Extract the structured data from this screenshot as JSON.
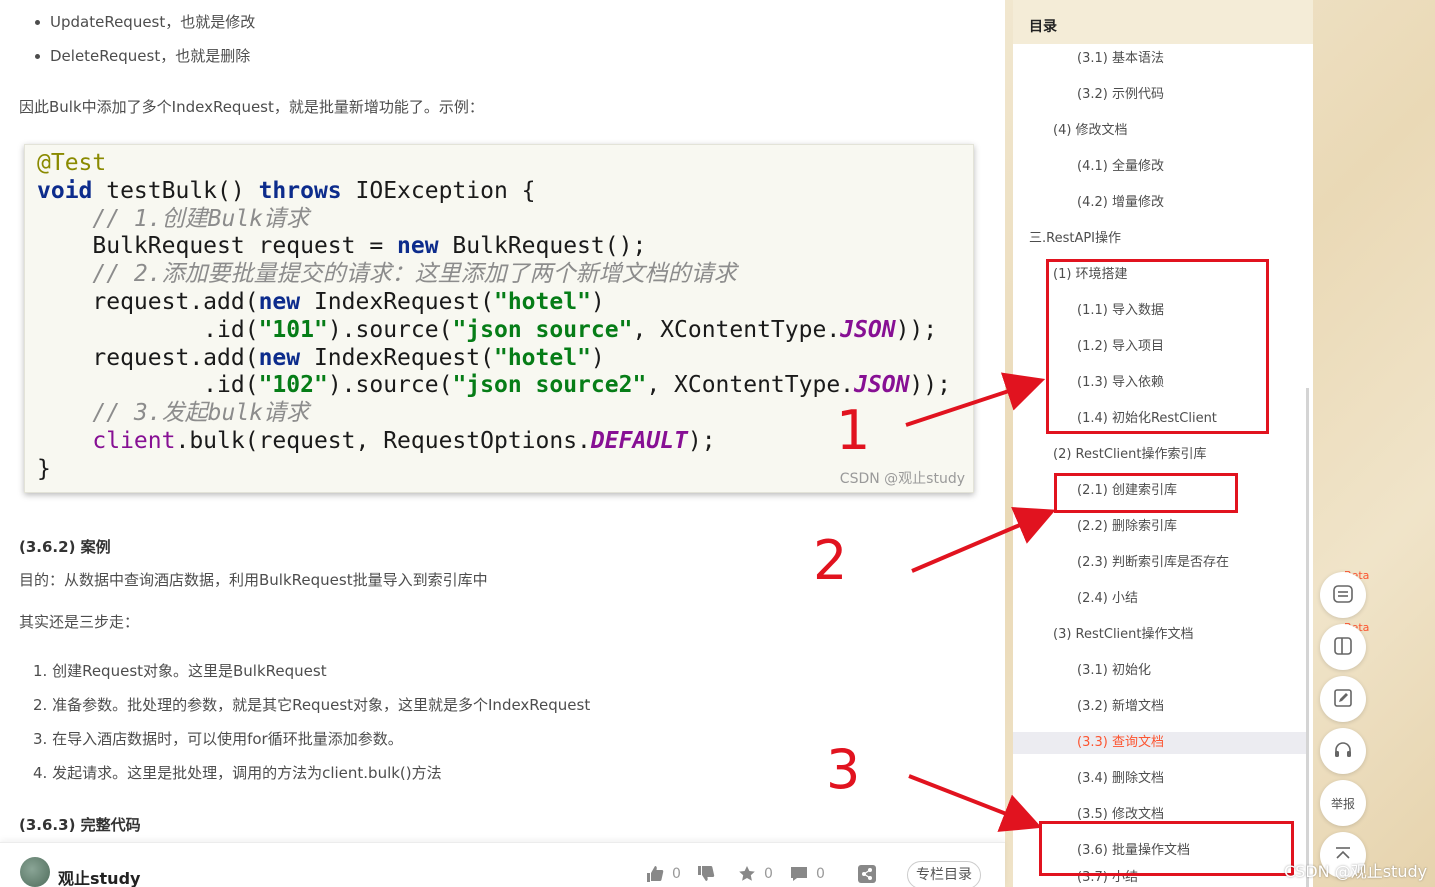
{
  "article": {
    "bullets": [
      "UpdateRequest，也就是修改",
      "DeleteRequest，也就是删除"
    ],
    "intro": "因此Bulk中添加了多个IndexRequest，就是批量新增功能了。示例：",
    "code_watermark": "CSDN @观止study",
    "section_case": "(3.6.2) 案例",
    "goal": "目的：从数据中查询酒店数据，利用BulkRequest批量导入到索引库中",
    "three_steps": "其实还是三步走：",
    "steps": [
      "1. 创建Request对象。这里是BulkRequest",
      "2. 准备参数。批处理的参数，就是其它Request对象，这里就是多个IndexRequest",
      "3. 在导入酒店数据时，可以使用for循环批量添加参数。",
      "4. 发起请求。这里是批处理，调用的方法为client.bulk()方法"
    ],
    "section_full_code": "(3.6.3) 完整代码"
  },
  "bottom_bar": {
    "author": "观止study",
    "like_count": "0",
    "dislike_count": "",
    "star_count": "0",
    "comment_count": "0",
    "column_button": "专栏目录"
  },
  "toc": {
    "title": "目录",
    "items": [
      "(3.1) 基本语法",
      "(3.2) 示例代码",
      "(4) 修改文档",
      "(4.1) 全量修改",
      "(4.2) 增量修改",
      "三.RestAPI操作",
      "(1) 环境搭建",
      "(1.1) 导入数据",
      "(1.2) 导入项目",
      "(1.3) 导入依赖",
      "(1.4) 初始化RestClient",
      "(2) RestClient操作索引库",
      "(2.1) 创建索引库",
      "(2.2) 删除索引库",
      "(2.3) 判断索引库是否存在",
      "(2.4) 小结",
      "(3) RestClient操作文档",
      "(3.1) 初始化",
      "(3.2) 新增文档",
      "(3.3) 查询文档",
      "(3.4) 删除文档",
      "(3.5) 修改文档",
      "(3.6) 批量操作文档",
      "(3.7) 小结"
    ],
    "active_item": "(3.3) 查询文档"
  },
  "annotations": {
    "numbers": [
      "1",
      "2",
      "3"
    ],
    "color": "#e1131f"
  },
  "side_buttons": {
    "beta_label": "Beta",
    "report_label": "举报"
  },
  "page_watermark": "CSDN @观止study",
  "colors": {
    "accent": "#fc5531",
    "annotation_red": "#e1131f"
  }
}
